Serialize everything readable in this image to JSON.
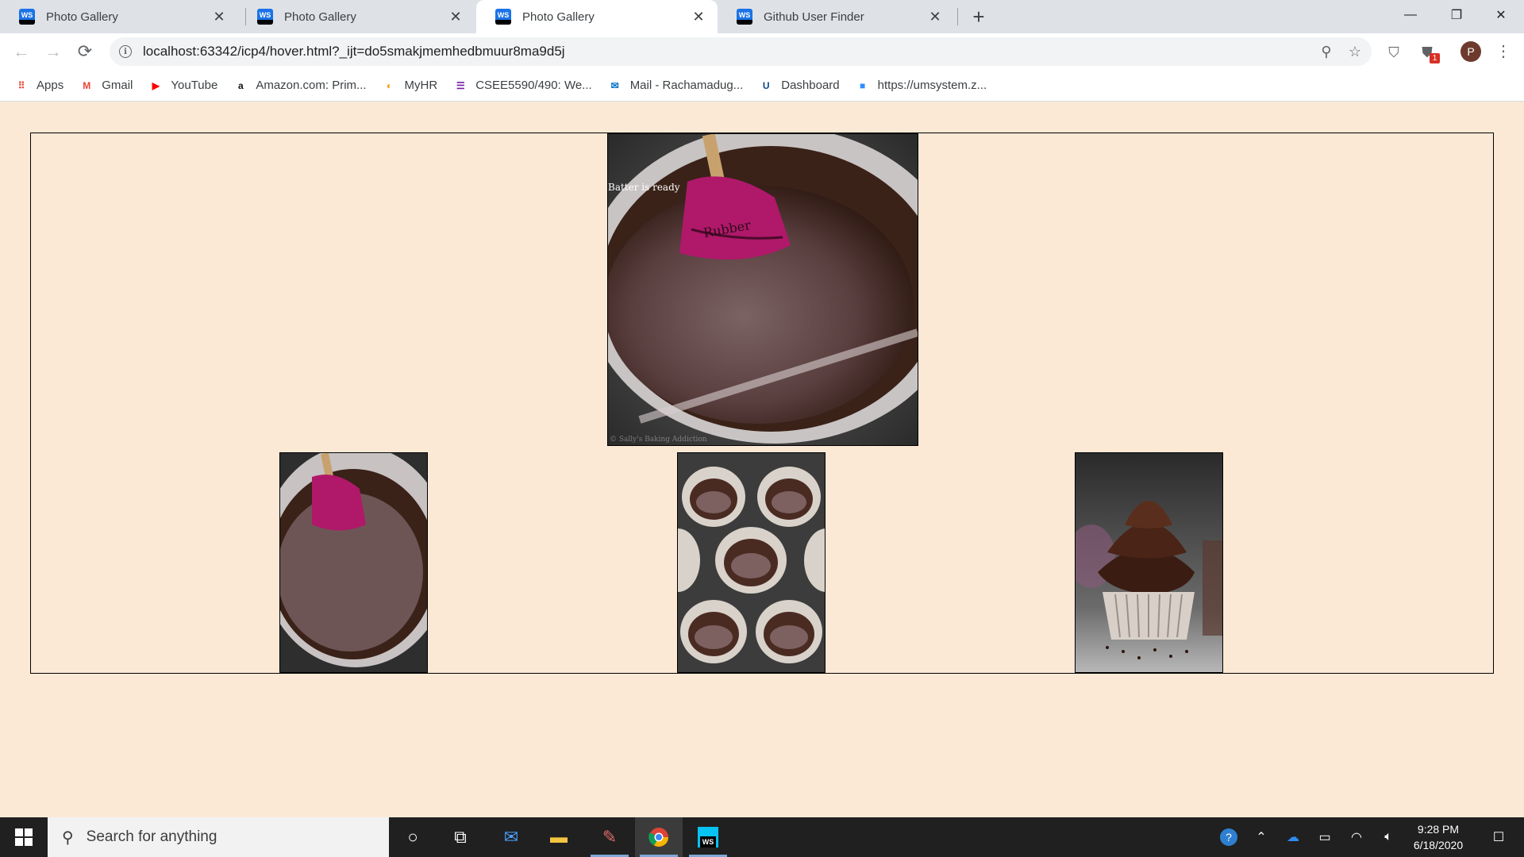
{
  "browser": {
    "tabs": [
      {
        "title": "Photo Gallery",
        "favicon": "webstorm-icon",
        "active": false
      },
      {
        "title": "Photo Gallery",
        "favicon": "webstorm-icon",
        "active": false
      },
      {
        "title": "Photo Gallery",
        "favicon": "webstorm-icon",
        "active": true
      },
      {
        "title": "Github User Finder",
        "favicon": "webstorm-icon",
        "active": false
      }
    ],
    "favicon_text": "WS",
    "close_glyph": "✕",
    "new_tab_glyph": "+",
    "window_controls": {
      "minimize": "—",
      "restore": "❐",
      "close": "✕"
    },
    "nav": {
      "back": "←",
      "forward": "→",
      "reload": "⟳"
    },
    "url": "localhost:63342/icp4/hover.html?_ijt=do5smakjmemhedbmuur8ma9d5j",
    "omnibox_icons": {
      "info": "i",
      "zoom": "⚲",
      "star": "☆"
    },
    "extensions": [
      {
        "name": "shield-extension-icon",
        "glyph": "⛉"
      },
      {
        "name": "adblock-extension-icon",
        "glyph": "⛊",
        "badge": "1"
      }
    ],
    "profile_initial": "P",
    "menu_glyph": "⋮"
  },
  "bookmarks": [
    {
      "label": "Apps",
      "icon": "apps-grid-icon",
      "glyph": "⠿",
      "color": "#ea4335"
    },
    {
      "label": "Gmail",
      "icon": "gmail-icon",
      "glyph": "M",
      "color": "#ea4335"
    },
    {
      "label": "YouTube",
      "icon": "youtube-icon",
      "glyph": "▶",
      "color": "#ff0000"
    },
    {
      "label": "Amazon.com: Prim...",
      "icon": "amazon-icon",
      "glyph": "a",
      "color": "#111111"
    },
    {
      "label": "MyHR",
      "icon": "myhr-icon",
      "glyph": "◐",
      "color": "#f29900"
    },
    {
      "label": "CSEE5590/490: We...",
      "icon": "onenote-icon",
      "glyph": "☰",
      "color": "#7719aa"
    },
    {
      "label": "Mail - Rachamadug...",
      "icon": "outlook-icon",
      "glyph": "✉",
      "color": "#0072c6"
    },
    {
      "label": "Dashboard",
      "icon": "umkc-icon",
      "glyph": "U",
      "color": "#0a4a8c"
    },
    {
      "label": "https://umsystem.z...",
      "icon": "zoom-icon",
      "glyph": "■",
      "color": "#2d8cff"
    }
  ],
  "gallery": {
    "featured_caption": "Batter is ready",
    "watermark": "© Sally's Baking Addiction",
    "thumbnails": [
      {
        "name": "thumbnail-batter-bowl",
        "alt": "batter"
      },
      {
        "name": "thumbnail-cupcake-liners",
        "alt": "liners"
      },
      {
        "name": "thumbnail-frosted-cupcake",
        "alt": "cupcake"
      }
    ]
  },
  "taskbar": {
    "search_placeholder": "Search for anything",
    "clock_time": "9:28 PM",
    "clock_date": "6/18/2020",
    "apps": [
      "cortana-icon",
      "task-view-icon",
      "mail-app-icon",
      "file-explorer-icon",
      "paint-icon",
      "chrome-icon",
      "webstorm-icon"
    ]
  },
  "colors": {
    "page_background": "#fbe9d6",
    "tab_strip": "#dee1e6",
    "taskbar": "#202020"
  }
}
